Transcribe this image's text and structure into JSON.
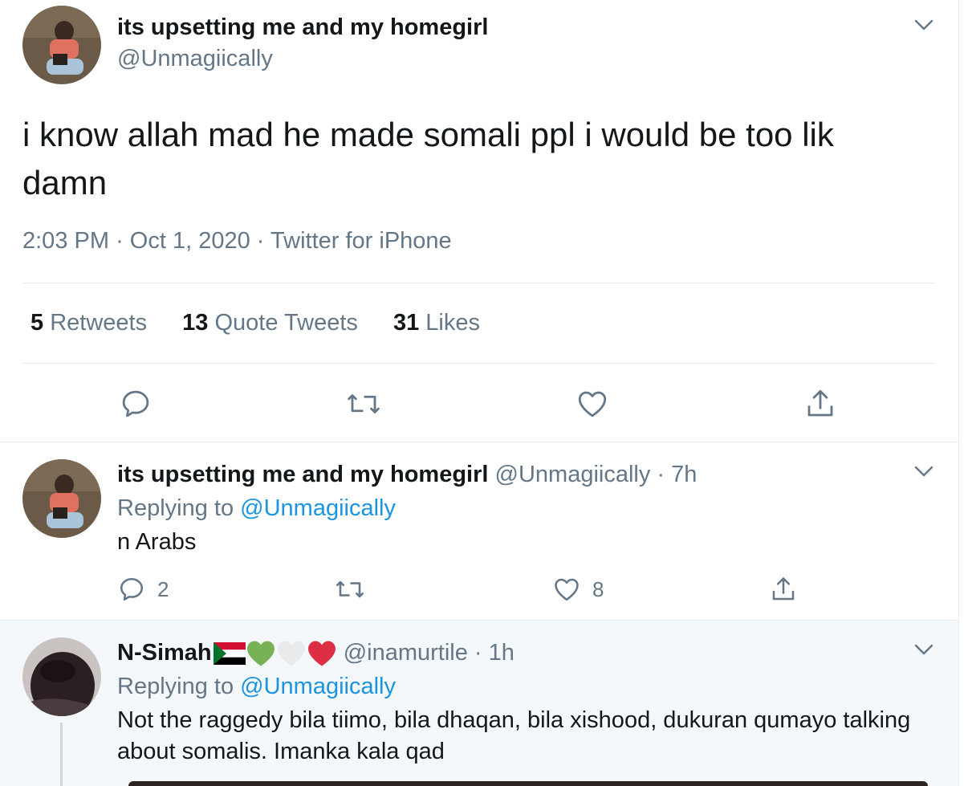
{
  "main_tweet": {
    "display_name": "its upsetting me and my homegirl",
    "handle": "@Unmagiically",
    "text": "i know allah mad he made somali ppl i would be too lik damn",
    "time": "2:03 PM",
    "date": "Oct 1, 2020",
    "source": "Twitter for iPhone",
    "meta_sep": "·",
    "stats": [
      {
        "count": "5",
        "label": "Retweets"
      },
      {
        "count": "13",
        "label": "Quote Tweets"
      },
      {
        "count": "31",
        "label": "Likes"
      }
    ]
  },
  "reply1": {
    "display_name": "its upsetting me and my homegirl",
    "handle": "@Unmagiically",
    "age": "· 7h",
    "replying_prefix": "Replying to",
    "replying_to": "@Unmagiically",
    "text": "n Arabs",
    "reply_count": "2",
    "like_count": "8"
  },
  "reply2": {
    "display_name": "N-Simah",
    "handle": "@inamurtile",
    "age": "· 1h",
    "replying_prefix": "Replying to",
    "replying_to": "@Unmagiically",
    "text": "Not the raggedy bila tiimo, bila dhaqan, bila xishood, dukuran qumayo talking about somalis. Imanka kala qad"
  },
  "colors": {
    "link": "#1b95e0",
    "muted": "#657786",
    "divider": "#e6ecf0",
    "reply_bg": "#f5f8fa"
  },
  "icons": [
    "chevron-down-icon",
    "reply-icon",
    "retweet-icon",
    "like-icon",
    "share-icon",
    "sudan-flag-icon",
    "green-heart-icon",
    "white-heart-icon",
    "red-heart-icon"
  ]
}
